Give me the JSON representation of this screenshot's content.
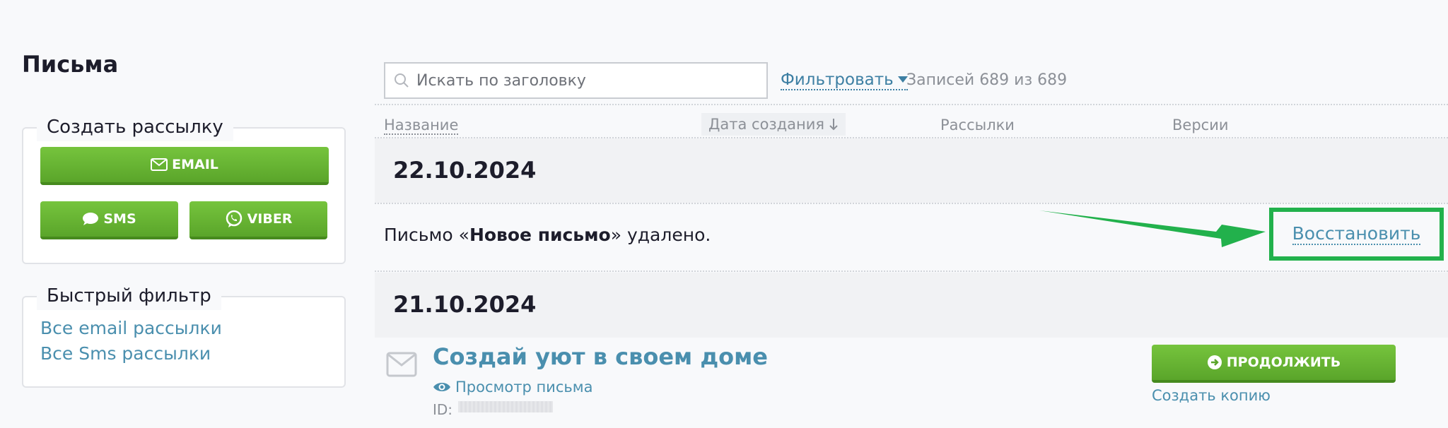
{
  "page": {
    "title": "Письма"
  },
  "sidebar": {
    "create": {
      "legend": "Создать рассылку",
      "email_label": "EMAIL",
      "sms_label": "SMS",
      "viber_label": "VIBER"
    },
    "quick_filter": {
      "legend": "Быстрый фильтр",
      "links": [
        "Все email рассылки",
        "Все Sms рассылки"
      ]
    }
  },
  "toolbar": {
    "search_placeholder": "Искать по заголовку",
    "filter_label": "Фильтровать",
    "records_text": "Записей 689 из 689"
  },
  "table": {
    "columns": [
      "Название",
      "Дата создания",
      "Рассылки",
      "Версии"
    ],
    "groups": [
      {
        "date": "22.10.2024"
      },
      {
        "date": "21.10.2024"
      }
    ]
  },
  "notice": {
    "prefix": "Письмо «",
    "name": "Новое письмо",
    "suffix": "» удалено.",
    "restore_label": "Восстановить"
  },
  "letter": {
    "title": "Создай уют в своем доме",
    "preview_label": "Просмотр письма",
    "id_label": "ID:",
    "continue_label": "ПРОДОЛЖИТЬ",
    "copy_label": "Создать копию"
  },
  "colors": {
    "accent_green": "#5aa52a",
    "link_blue": "#4a8fae",
    "highlight_green": "#22b14c"
  }
}
